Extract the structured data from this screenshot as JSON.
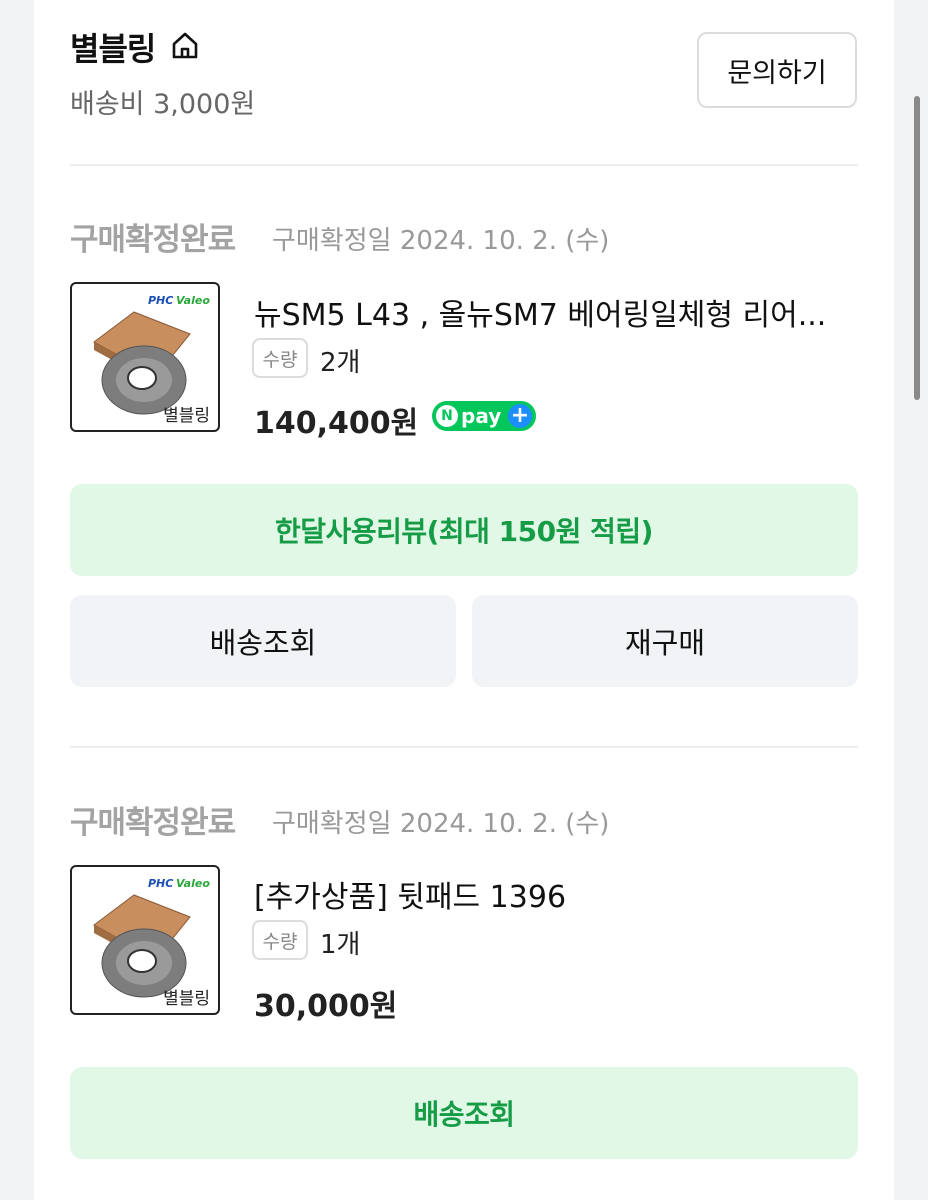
{
  "store": {
    "name": "별블링",
    "shipping_fee": "배송비 3,000원",
    "inquiry_label": "문의하기"
  },
  "orders": [
    {
      "status": "구매확정완료",
      "confirm_date": "구매확정일 2024. 10. 2. (수)",
      "thumbnail": {
        "brand_text": "PHC Valeo",
        "caption": "별블링"
      },
      "product_name": "뉴SM5 L43 , 올뉴SM7 베어링일체형 리어...",
      "qty_label": "수량",
      "qty_value": "2개",
      "price": "140,400원",
      "npay_badge": "pay",
      "buttons": {
        "review": "한달사용리뷰(최대 150원 적립)",
        "track": "배송조회",
        "rebuy": "재구매"
      }
    },
    {
      "status": "구매확정완료",
      "confirm_date": "구매확정일 2024. 10. 2. (수)",
      "thumbnail": {
        "brand_text": "PHC Valeo",
        "caption": "별블링"
      },
      "product_name": "[추가상품] 뒷패드 1396",
      "qty_label": "수량",
      "qty_value": "1개",
      "price": "30,000원",
      "buttons": {
        "track": "배송조회"
      }
    }
  ],
  "colors": {
    "accent_green": "#169c46",
    "green_button_bg": "#e1f8e7",
    "gray_button_bg": "#f1f3f6",
    "npay_green": "#03c75a",
    "npay_plus_blue": "#1d8eff"
  },
  "icons": [
    "home-icon",
    "npay-plus-icon"
  ]
}
